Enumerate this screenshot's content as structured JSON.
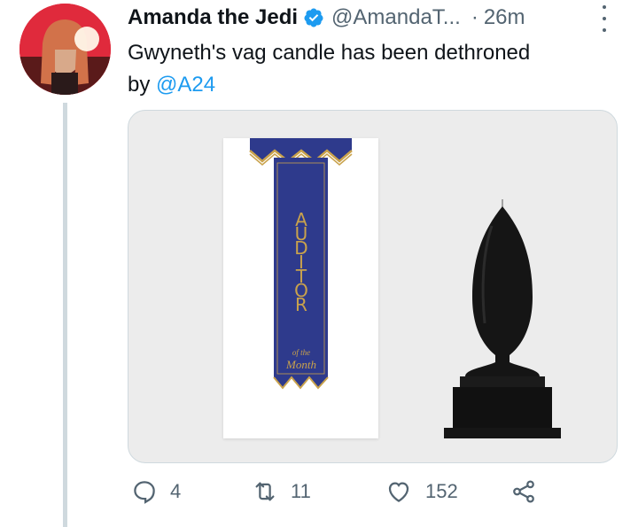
{
  "tweet": {
    "author_name": "Amanda the Jedi",
    "handle": "@AmandaT...",
    "separator": "·",
    "time": "26m",
    "text_main": "Gwyneth's vag candle has been dethroned",
    "text_by": "by ",
    "mention": "@A24"
  },
  "media": {
    "ribbon_letters": [
      "A",
      "U",
      "D",
      "I",
      "T",
      "O",
      "R"
    ],
    "ribbon_sub_small": "of the",
    "ribbon_sub_big": "Month",
    "ribbon_color": "#2e3a8c",
    "ribbon_text_color": "#c9a24c"
  },
  "actions": {
    "reply_count": "4",
    "retweet_count": "11",
    "like_count": "152"
  },
  "colors": {
    "accent": "#1d9bf0",
    "muted": "#536471",
    "thread_line": "#cfd9de"
  }
}
